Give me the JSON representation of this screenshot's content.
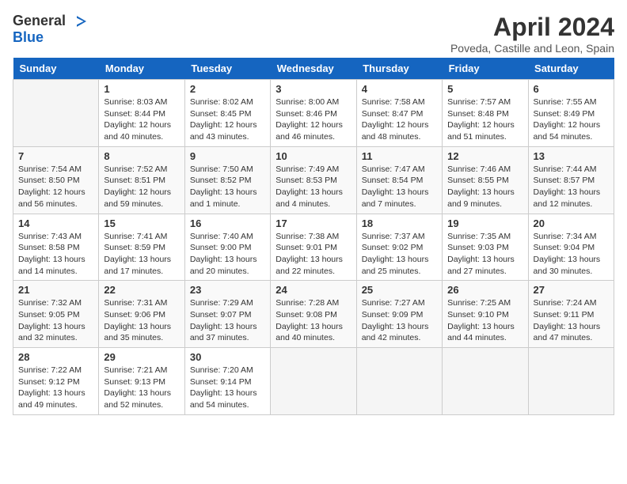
{
  "logo": {
    "general": "General",
    "blue": "Blue"
  },
  "title": "April 2024",
  "location": "Poveda, Castille and Leon, Spain",
  "headers": [
    "Sunday",
    "Monday",
    "Tuesday",
    "Wednesday",
    "Thursday",
    "Friday",
    "Saturday"
  ],
  "weeks": [
    [
      {
        "day": "",
        "sunrise": "",
        "sunset": "",
        "daylight": ""
      },
      {
        "day": "1",
        "sunrise": "Sunrise: 8:03 AM",
        "sunset": "Sunset: 8:44 PM",
        "daylight": "Daylight: 12 hours and 40 minutes."
      },
      {
        "day": "2",
        "sunrise": "Sunrise: 8:02 AM",
        "sunset": "Sunset: 8:45 PM",
        "daylight": "Daylight: 12 hours and 43 minutes."
      },
      {
        "day": "3",
        "sunrise": "Sunrise: 8:00 AM",
        "sunset": "Sunset: 8:46 PM",
        "daylight": "Daylight: 12 hours and 46 minutes."
      },
      {
        "day": "4",
        "sunrise": "Sunrise: 7:58 AM",
        "sunset": "Sunset: 8:47 PM",
        "daylight": "Daylight: 12 hours and 48 minutes."
      },
      {
        "day": "5",
        "sunrise": "Sunrise: 7:57 AM",
        "sunset": "Sunset: 8:48 PM",
        "daylight": "Daylight: 12 hours and 51 minutes."
      },
      {
        "day": "6",
        "sunrise": "Sunrise: 7:55 AM",
        "sunset": "Sunset: 8:49 PM",
        "daylight": "Daylight: 12 hours and 54 minutes."
      }
    ],
    [
      {
        "day": "7",
        "sunrise": "Sunrise: 7:54 AM",
        "sunset": "Sunset: 8:50 PM",
        "daylight": "Daylight: 12 hours and 56 minutes."
      },
      {
        "day": "8",
        "sunrise": "Sunrise: 7:52 AM",
        "sunset": "Sunset: 8:51 PM",
        "daylight": "Daylight: 12 hours and 59 minutes."
      },
      {
        "day": "9",
        "sunrise": "Sunrise: 7:50 AM",
        "sunset": "Sunset: 8:52 PM",
        "daylight": "Daylight: 13 hours and 1 minute."
      },
      {
        "day": "10",
        "sunrise": "Sunrise: 7:49 AM",
        "sunset": "Sunset: 8:53 PM",
        "daylight": "Daylight: 13 hours and 4 minutes."
      },
      {
        "day": "11",
        "sunrise": "Sunrise: 7:47 AM",
        "sunset": "Sunset: 8:54 PM",
        "daylight": "Daylight: 13 hours and 7 minutes."
      },
      {
        "day": "12",
        "sunrise": "Sunrise: 7:46 AM",
        "sunset": "Sunset: 8:55 PM",
        "daylight": "Daylight: 13 hours and 9 minutes."
      },
      {
        "day": "13",
        "sunrise": "Sunrise: 7:44 AM",
        "sunset": "Sunset: 8:57 PM",
        "daylight": "Daylight: 13 hours and 12 minutes."
      }
    ],
    [
      {
        "day": "14",
        "sunrise": "Sunrise: 7:43 AM",
        "sunset": "Sunset: 8:58 PM",
        "daylight": "Daylight: 13 hours and 14 minutes."
      },
      {
        "day": "15",
        "sunrise": "Sunrise: 7:41 AM",
        "sunset": "Sunset: 8:59 PM",
        "daylight": "Daylight: 13 hours and 17 minutes."
      },
      {
        "day": "16",
        "sunrise": "Sunrise: 7:40 AM",
        "sunset": "Sunset: 9:00 PM",
        "daylight": "Daylight: 13 hours and 20 minutes."
      },
      {
        "day": "17",
        "sunrise": "Sunrise: 7:38 AM",
        "sunset": "Sunset: 9:01 PM",
        "daylight": "Daylight: 13 hours and 22 minutes."
      },
      {
        "day": "18",
        "sunrise": "Sunrise: 7:37 AM",
        "sunset": "Sunset: 9:02 PM",
        "daylight": "Daylight: 13 hours and 25 minutes."
      },
      {
        "day": "19",
        "sunrise": "Sunrise: 7:35 AM",
        "sunset": "Sunset: 9:03 PM",
        "daylight": "Daylight: 13 hours and 27 minutes."
      },
      {
        "day": "20",
        "sunrise": "Sunrise: 7:34 AM",
        "sunset": "Sunset: 9:04 PM",
        "daylight": "Daylight: 13 hours and 30 minutes."
      }
    ],
    [
      {
        "day": "21",
        "sunrise": "Sunrise: 7:32 AM",
        "sunset": "Sunset: 9:05 PM",
        "daylight": "Daylight: 13 hours and 32 minutes."
      },
      {
        "day": "22",
        "sunrise": "Sunrise: 7:31 AM",
        "sunset": "Sunset: 9:06 PM",
        "daylight": "Daylight: 13 hours and 35 minutes."
      },
      {
        "day": "23",
        "sunrise": "Sunrise: 7:29 AM",
        "sunset": "Sunset: 9:07 PM",
        "daylight": "Daylight: 13 hours and 37 minutes."
      },
      {
        "day": "24",
        "sunrise": "Sunrise: 7:28 AM",
        "sunset": "Sunset: 9:08 PM",
        "daylight": "Daylight: 13 hours and 40 minutes."
      },
      {
        "day": "25",
        "sunrise": "Sunrise: 7:27 AM",
        "sunset": "Sunset: 9:09 PM",
        "daylight": "Daylight: 13 hours and 42 minutes."
      },
      {
        "day": "26",
        "sunrise": "Sunrise: 7:25 AM",
        "sunset": "Sunset: 9:10 PM",
        "daylight": "Daylight: 13 hours and 44 minutes."
      },
      {
        "day": "27",
        "sunrise": "Sunrise: 7:24 AM",
        "sunset": "Sunset: 9:11 PM",
        "daylight": "Daylight: 13 hours and 47 minutes."
      }
    ],
    [
      {
        "day": "28",
        "sunrise": "Sunrise: 7:22 AM",
        "sunset": "Sunset: 9:12 PM",
        "daylight": "Daylight: 13 hours and 49 minutes."
      },
      {
        "day": "29",
        "sunrise": "Sunrise: 7:21 AM",
        "sunset": "Sunset: 9:13 PM",
        "daylight": "Daylight: 13 hours and 52 minutes."
      },
      {
        "day": "30",
        "sunrise": "Sunrise: 7:20 AM",
        "sunset": "Sunset: 9:14 PM",
        "daylight": "Daylight: 13 hours and 54 minutes."
      },
      {
        "day": "",
        "sunrise": "",
        "sunset": "",
        "daylight": ""
      },
      {
        "day": "",
        "sunrise": "",
        "sunset": "",
        "daylight": ""
      },
      {
        "day": "",
        "sunrise": "",
        "sunset": "",
        "daylight": ""
      },
      {
        "day": "",
        "sunrise": "",
        "sunset": "",
        "daylight": ""
      }
    ]
  ]
}
